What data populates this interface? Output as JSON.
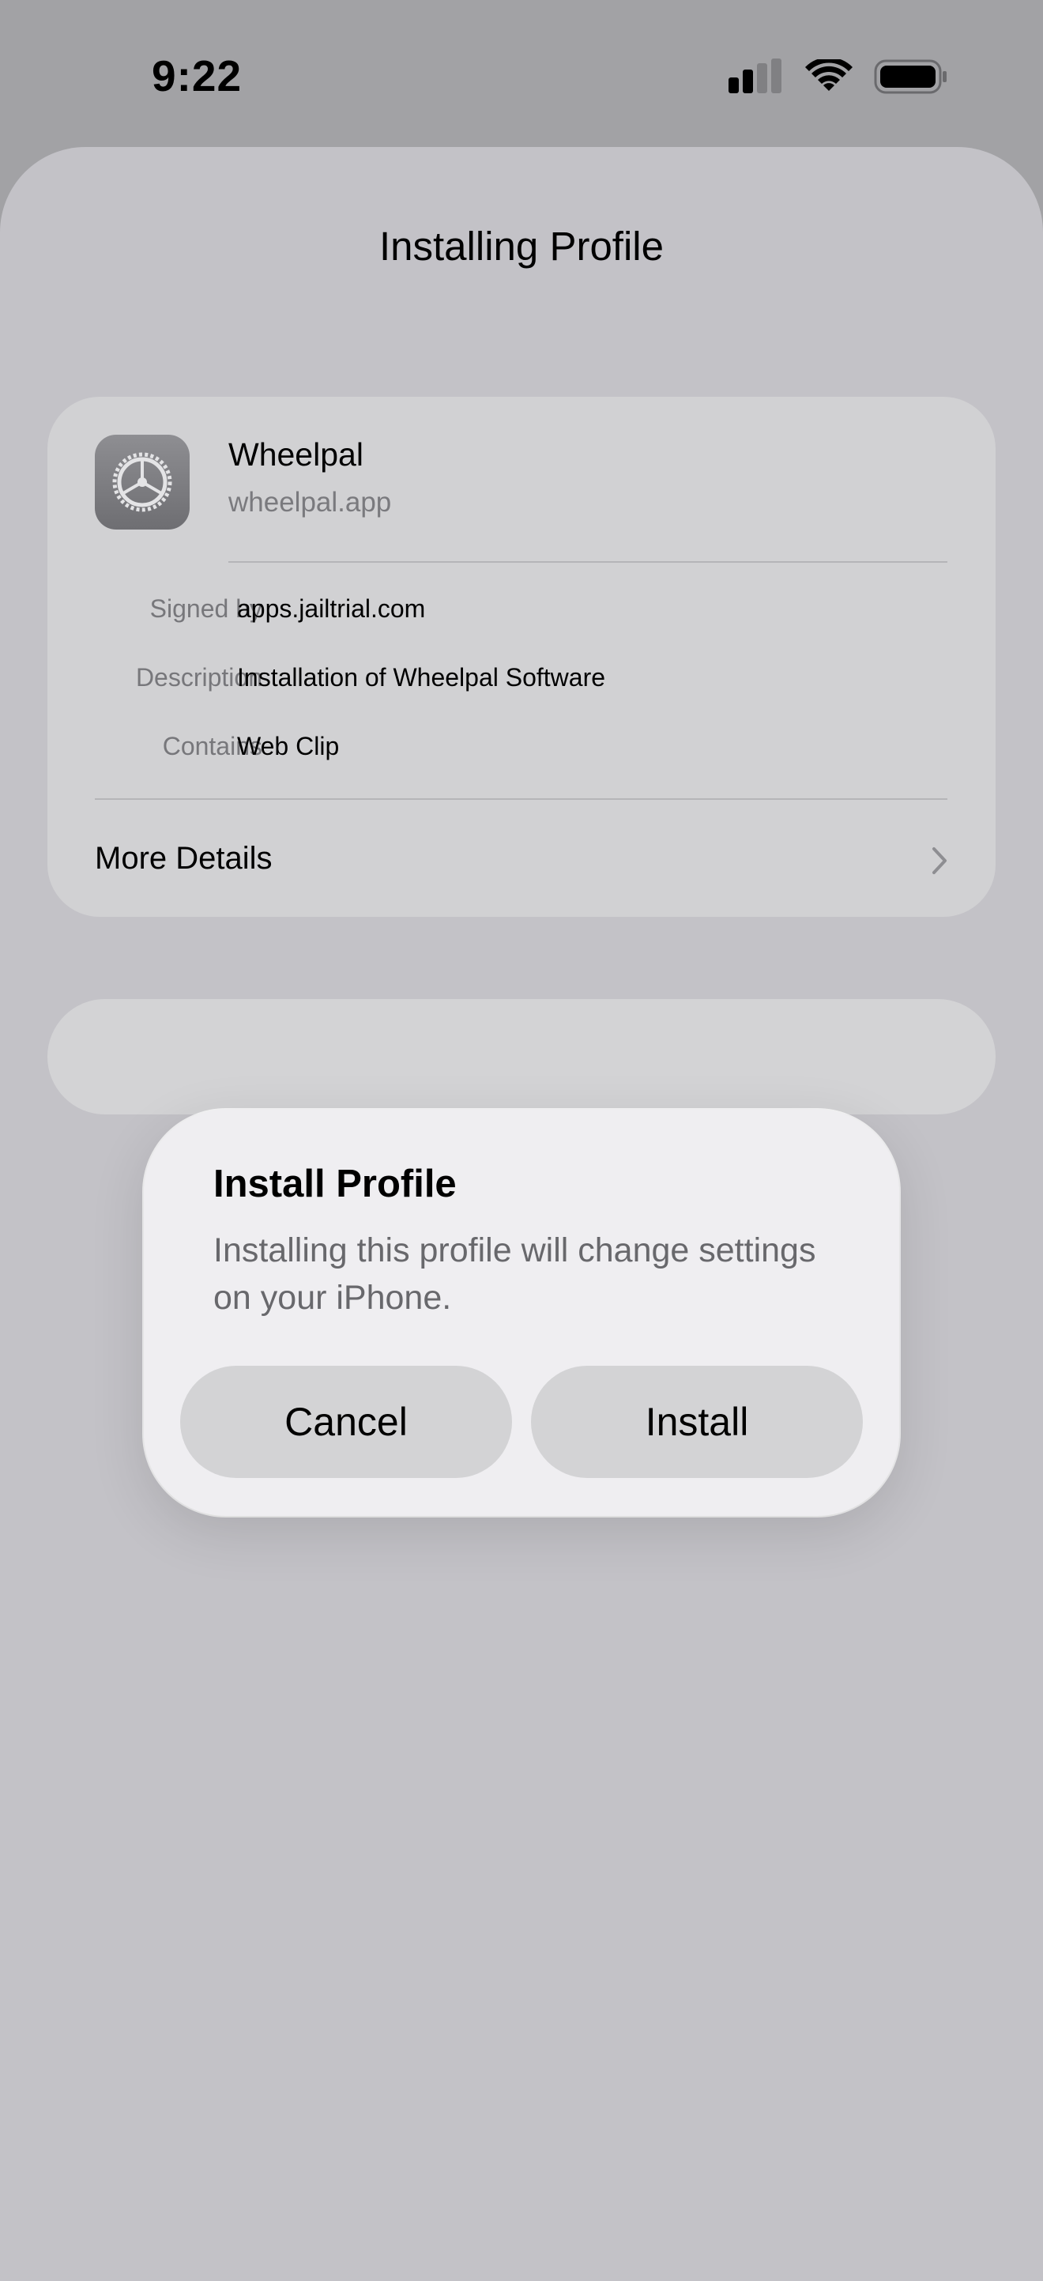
{
  "status_bar": {
    "time": "9:22",
    "icons": [
      "cellular-signal-icon",
      "wifi-icon",
      "battery-icon"
    ]
  },
  "sheet": {
    "title": "Installing Profile"
  },
  "profile": {
    "icon": "settings-gear-icon",
    "name": "Wheelpal",
    "domain": "wheelpal.app",
    "details": [
      {
        "label": "Signed by",
        "value": "apps.jailtrial.com"
      },
      {
        "label": "Description",
        "value": "Installation of Wheelpal Software"
      },
      {
        "label": "Contains",
        "value": "Web Clip"
      }
    ],
    "more_details_label": "More Details"
  },
  "alert": {
    "title": "Install Profile",
    "message": "Installing this profile will change settings on your iPhone.",
    "cancel_label": "Cancel",
    "install_label": "Install"
  },
  "colors": {
    "sheet_background": "#c3c2c7",
    "card_background": "#d1d1d3",
    "alert_background": "#efeef1",
    "button_background": "#d3d3d5"
  }
}
